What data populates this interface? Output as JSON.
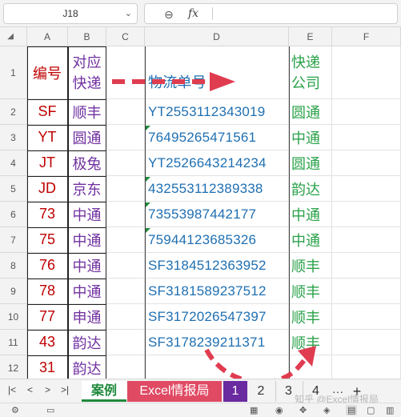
{
  "formula_bar": {
    "name_box": "J18",
    "name_box_icon": "chevron-down-icon",
    "zoom_icon": "zoom-icon",
    "fx_label": "fx",
    "formula": ""
  },
  "sheet": {
    "columns": [
      "A",
      "B",
      "C",
      "D",
      "E",
      "F"
    ],
    "row_numbers": [
      "1",
      "2",
      "3",
      "4",
      "5",
      "6",
      "7",
      "8",
      "9",
      "10",
      "11",
      "12"
    ],
    "header": {
      "code": "编号",
      "name_line1": "对应",
      "name_line2": "快递",
      "tracking": "物流单号",
      "company_line1": "快递",
      "company_line2": "公司"
    },
    "rows": [
      {
        "code": "SF",
        "name": "顺丰",
        "tracking": "YT2553112343019",
        "company": "圆通",
        "text_marker": false
      },
      {
        "code": "YT",
        "name": "圆通",
        "tracking": "76495265471561",
        "company": "中通",
        "text_marker": true
      },
      {
        "code": "JT",
        "name": "极兔",
        "tracking": "YT2526643214234",
        "company": "圆通",
        "text_marker": false
      },
      {
        "code": "JD",
        "name": "京东",
        "tracking": "432553112389338",
        "company": "韵达",
        "text_marker": true
      },
      {
        "code": "73",
        "name": "中通",
        "tracking": "73553987442177",
        "company": "中通",
        "text_marker": true
      },
      {
        "code": "75",
        "name": "中通",
        "tracking": "75944123685326",
        "company": "中通",
        "text_marker": true
      },
      {
        "code": "76",
        "name": "中通",
        "tracking": "SF3184512363952",
        "company": "顺丰",
        "text_marker": false
      },
      {
        "code": "78",
        "name": "中通",
        "tracking": "SF3181589237512",
        "company": "顺丰",
        "text_marker": false
      },
      {
        "code": "77",
        "name": "申通",
        "tracking": "SF3172026547397",
        "company": "顺丰",
        "text_marker": false
      },
      {
        "code": "43",
        "name": "韵达",
        "tracking": "SF3178239211371",
        "company": "顺丰",
        "text_marker": false
      },
      {
        "code": "31",
        "name": "韵达",
        "tracking": "",
        "company": "",
        "text_marker": false
      }
    ],
    "colors": {
      "code": "#c00000",
      "name": "#7030a0",
      "tracking": "#1f6fb2",
      "company": "#2aa24a",
      "arrow": "#e03c50"
    }
  },
  "tabs": {
    "nav": [
      "|<",
      "<",
      ">",
      ">|"
    ],
    "items": [
      "案例",
      "Excel情报局",
      "1",
      "2",
      "3",
      "4"
    ],
    "more": "···",
    "add": "+",
    "active_tab_color": "#1e8a3c",
    "excel_tab_color": "#e04a63",
    "tab1_color": "#6a2aa0"
  },
  "watermark": "知乎 @Excel情报局",
  "status_bar": {
    "left_icons": [
      "sheet-settings-icon",
      "layout-icon"
    ],
    "right_icons": [
      "table-icon",
      "eye-icon",
      "move-icon",
      "fill-icon",
      "normal-view-icon",
      "page-layout-icon",
      "page-break-icon"
    ]
  }
}
